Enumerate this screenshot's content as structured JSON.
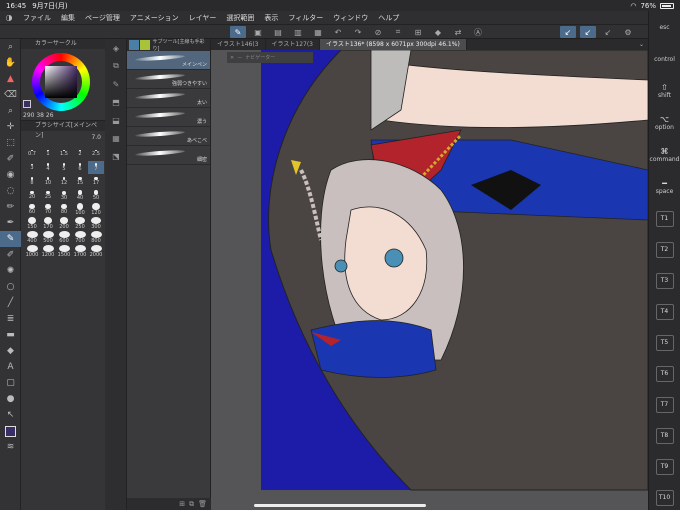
{
  "status": {
    "time": "16:45",
    "date": "9月7日(月)",
    "battery": "76%"
  },
  "menu": [
    "ファイル",
    "編集",
    "ページ管理",
    "アニメーション",
    "レイヤー",
    "選択範囲",
    "表示",
    "フィルター",
    "ウィンドウ",
    "ヘルプ"
  ],
  "color_panel": {
    "title": "カラーサークル",
    "hsv": "290 38 26",
    "current_color": "#3b2d66"
  },
  "brush_size": {
    "title": "ブラシサイズ[メインペン]",
    "value": "7.0",
    "sizes": [
      "0.7",
      "1",
      "1.5",
      "2",
      "2.5",
      "3",
      "4",
      "5",
      "6",
      "7",
      "8",
      "10",
      "12",
      "15",
      "17",
      "20",
      "25",
      "30",
      "40",
      "50",
      "60",
      "70",
      "80",
      "100",
      "120",
      "150",
      "170",
      "200",
      "250",
      "300",
      "400",
      "500",
      "600",
      "700",
      "800",
      "1000",
      "1200",
      "1500",
      "1700",
      "2000"
    ],
    "selected": "7"
  },
  "subtool": {
    "title": "サブツール[主線も手彩り]",
    "brushes": [
      {
        "label": "メインペン",
        "selected": true
      },
      {
        "label": "強弱つきやすい",
        "selected": false
      },
      {
        "label": "太い",
        "selected": false
      },
      {
        "label": "濃う",
        "selected": false
      },
      {
        "label": "あべこべ",
        "selected": false
      },
      {
        "label": "細密",
        "selected": false
      }
    ]
  },
  "doc_tabs": [
    {
      "label": "イラスト146(3",
      "active": false
    },
    {
      "label": "イラスト127(3",
      "active": false
    },
    {
      "label": "イラスト136* (8598 x 6071px 300dpi 46.1%)",
      "active": true
    }
  ],
  "mini_bar": {
    "close": "✕",
    "minimize": "—",
    "label": "ナビゲーター"
  },
  "right_bar": {
    "keys": [
      {
        "sym": "",
        "label": "esc"
      },
      {
        "sym": "",
        "label": "control"
      },
      {
        "sym": "⇧",
        "label": "shift"
      },
      {
        "sym": "⌥",
        "label": "option"
      },
      {
        "sym": "⌘",
        "label": "command"
      },
      {
        "sym": "━",
        "label": "space"
      }
    ],
    "numbers": [
      "T1",
      "T2",
      "T3",
      "T4",
      "T5",
      "T6",
      "T7",
      "T8",
      "T9",
      "T10"
    ]
  },
  "colors": {
    "canvas_bg": "#1c1ca8",
    "accent": "#4c6a8a",
    "cloak": "#4a4542",
    "collar_red": "#b3232b",
    "collar_blue": "#1a36b0",
    "hair": "#c8bfbe",
    "skin": "#f3ddd2",
    "eye": "#4a8fb5"
  }
}
